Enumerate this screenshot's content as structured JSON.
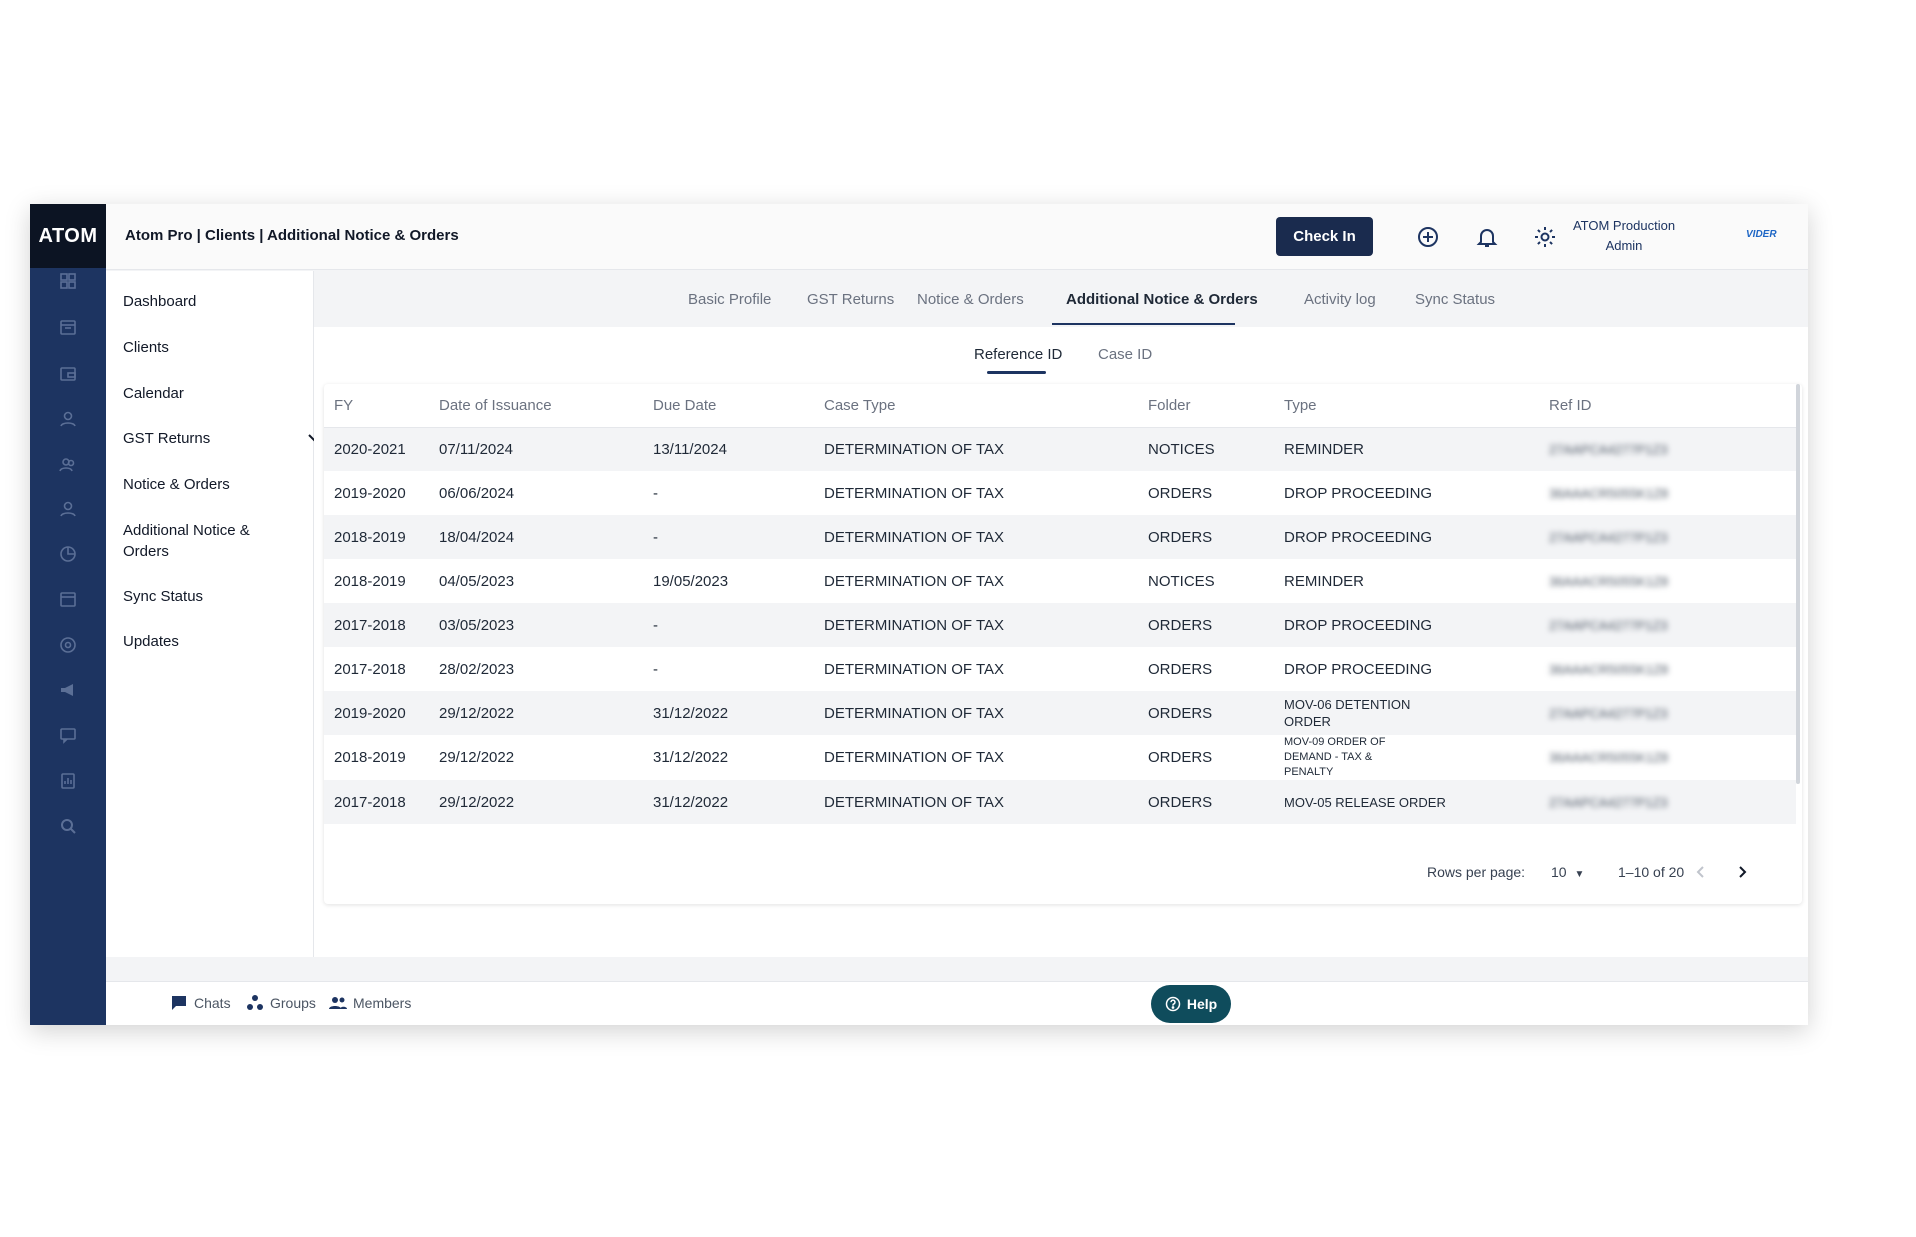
{
  "app": {
    "logo": "ATOM",
    "breadcrumb": "Atom Pro | Clients | Additional Notice & Orders"
  },
  "header": {
    "check_in_label": "Check In",
    "user_name": "ATOM Production",
    "user_role": "Admin",
    "brand": "VIDER",
    "icons": [
      "add-circle-icon",
      "bell-icon",
      "gear-icon"
    ]
  },
  "sidebar": {
    "items": [
      {
        "label": "Dashboard"
      },
      {
        "label": "Clients"
      },
      {
        "label": "Calendar"
      },
      {
        "label": "GST Returns"
      },
      {
        "label": "Notice & Orders"
      },
      {
        "label": "Additional Notice &"
      },
      {
        "label": "Orders"
      },
      {
        "label": "Sync Status"
      },
      {
        "label": "Updates"
      }
    ]
  },
  "tabs": [
    {
      "label": "Basic Profile"
    },
    {
      "label": "GST Returns"
    },
    {
      "label": "Notice & Orders"
    },
    {
      "label": "Additional Notice & Orders"
    },
    {
      "label": "Activity log"
    },
    {
      "label": "Sync Status"
    }
  ],
  "subtabs": [
    {
      "label": "Reference ID"
    },
    {
      "label": "Case ID"
    }
  ],
  "table": {
    "columns": [
      "FY",
      "Date of Issuance",
      "Due Date",
      "Case Type",
      "Folder",
      "Type",
      "Ref ID"
    ],
    "rows": [
      [
        "2020-2021",
        "07/11/2024",
        "13/11/2024",
        "DETERMINATION OF TAX",
        "NOTICES",
        "REMINDER",
        "27AAPCA4277P1Z3"
      ],
      [
        "2019-2020",
        "06/06/2024",
        "-",
        "DETERMINATION OF TAX",
        "ORDERS",
        "DROP PROCEEDING",
        "36AAACR5055K1Z8"
      ],
      [
        "2018-2019",
        "18/04/2024",
        "-",
        "DETERMINATION OF TAX",
        "ORDERS",
        "DROP PROCEEDING",
        "27AAPCA4277P1Z3"
      ],
      [
        "2018-2019",
        "04/05/2023",
        "19/05/2023",
        "DETERMINATION OF TAX",
        "NOTICES",
        "REMINDER",
        "36AAACR5055K1Z8"
      ],
      [
        "2017-2018",
        "03/05/2023",
        "-",
        "DETERMINATION OF TAX",
        "ORDERS",
        "DROP PROCEEDING",
        "27AAPCA4277P1Z3"
      ],
      [
        "2017-2018",
        "28/02/2023",
        "-",
        "DETERMINATION OF TAX",
        "ORDERS",
        "DROP PROCEEDING",
        "36AAACR5055K1Z8"
      ],
      [
        "2019-2020",
        "29/12/2022",
        "31/12/2022",
        "DETERMINATION OF TAX",
        "ORDERS",
        "MOV-06 DETENTION ORDER",
        "27AAPCA4277P1Z3"
      ],
      [
        "2018-2019",
        "29/12/2022",
        "31/12/2022",
        "DETERMINATION OF TAX",
        "ORDERS",
        "MOV-09 ORDER OF DEMAND - TAX & PENALTY",
        "36AAACR5055K1Z8"
      ],
      [
        "2017-2018",
        "29/12/2022",
        "31/12/2022",
        "DETERMINATION OF TAX",
        "ORDERS",
        "MOV-05 RELEASE ORDER",
        "27AAPCA4277P1Z3"
      ]
    ]
  },
  "pagination": {
    "rows_per_page_label": "Rows per page:",
    "rows_per_page": "10",
    "range": "1–10 of 20"
  },
  "footer": {
    "chats": "Chats",
    "groups": "Groups",
    "members": "Members",
    "help": "Help"
  }
}
